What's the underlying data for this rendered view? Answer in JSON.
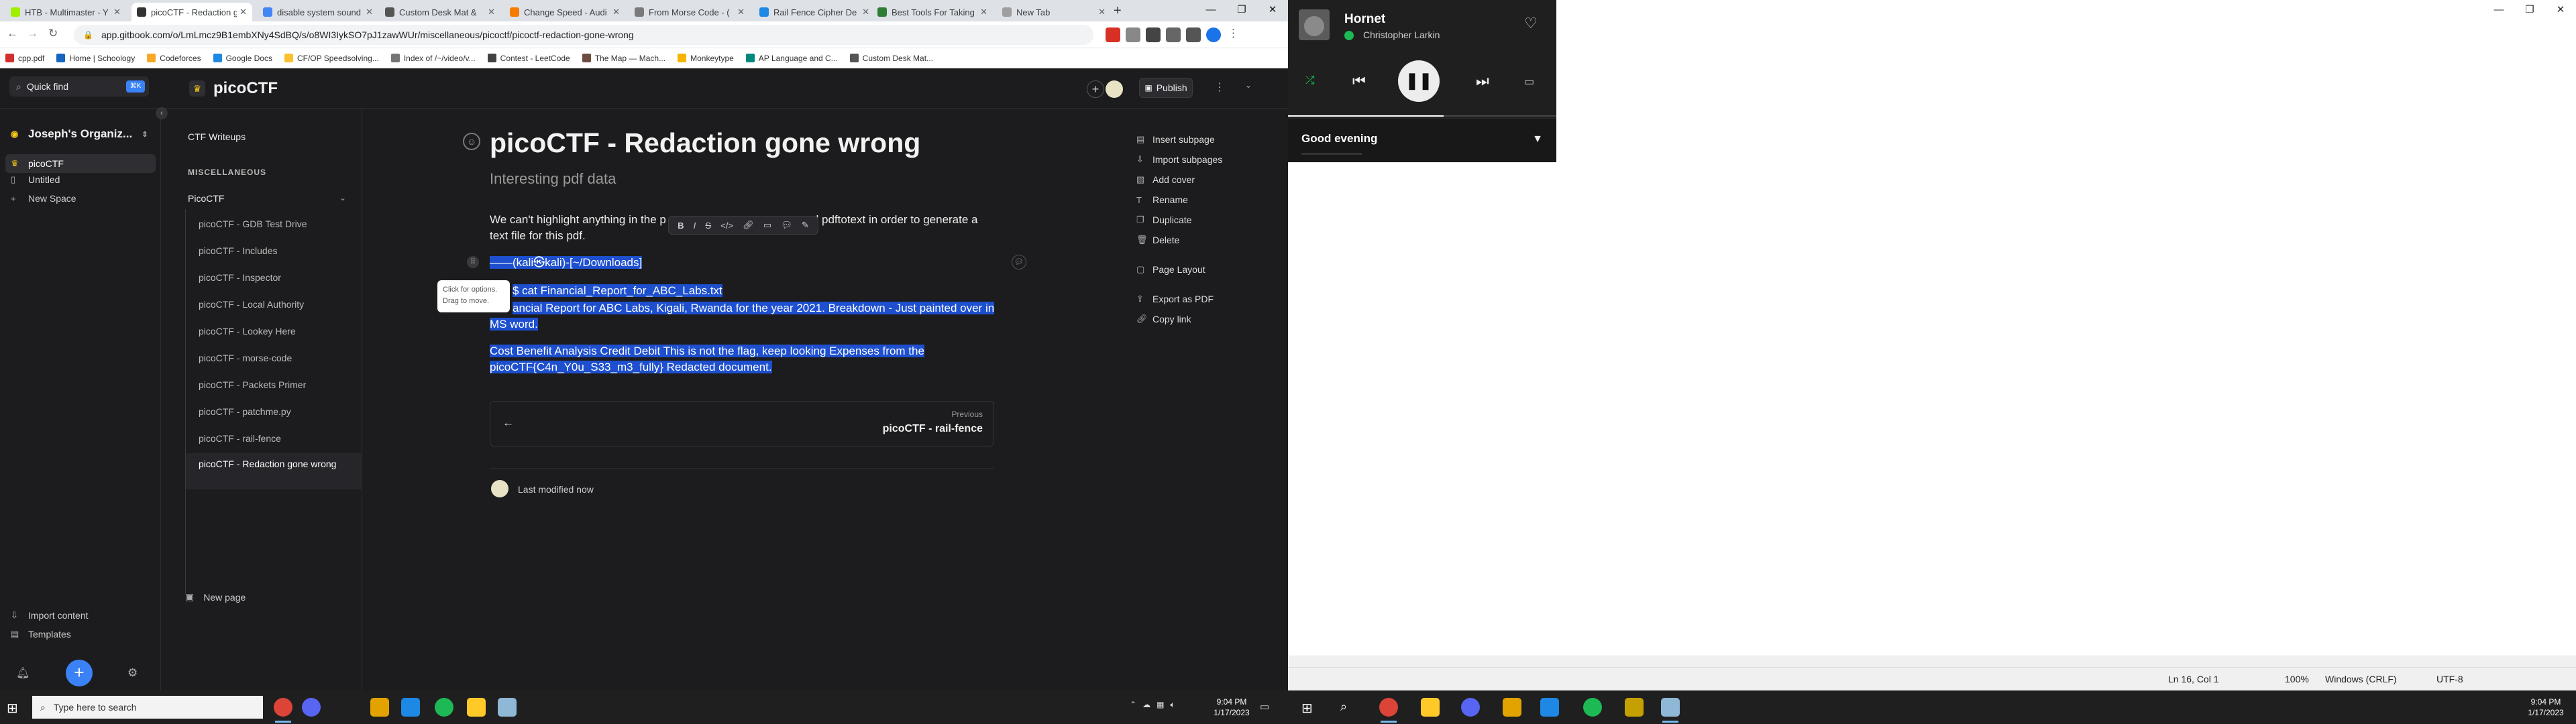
{
  "browser": {
    "tabs": [
      {
        "title": "HTB - Multimaster - Y",
        "color": "#9fef00"
      },
      {
        "title": "picoCTF - Redaction g",
        "color": "#333333",
        "active": true
      },
      {
        "title": "disable system sound",
        "color": "#4285f4"
      },
      {
        "title": "Custom Desk Mat &",
        "color": "#555555"
      },
      {
        "title": "Change Speed - Audi",
        "color": "#f57c00"
      },
      {
        "title": "From Morse Code - (",
        "color": "#7a7a7a"
      },
      {
        "title": "Rail Fence Cipher De",
        "color": "#1e88e5"
      },
      {
        "title": "Best Tools For Taking",
        "color": "#2e7d32"
      },
      {
        "title": "New Tab",
        "color": "#9e9e9e"
      }
    ],
    "new_tab": "+",
    "url": "app.gitbook.com/o/LmLmcz9B1embXNy4SdBQ/s/o8WI3IykSO7pJ1zawWUr/miscellaneous/picoctf/picoctf-redaction-gone-wrong",
    "bookmarks": [
      {
        "label": "cpp.pdf",
        "color": "#d32f2f"
      },
      {
        "label": "Home | Schoology",
        "color": "#1565c0"
      },
      {
        "label": "Codeforces",
        "color": "#f9a825"
      },
      {
        "label": "Google Docs",
        "color": "#1e88e5"
      },
      {
        "label": "CF/OP Speedsolving...",
        "color": "#fbc02d"
      },
      {
        "label": "Index of /~/video/v...",
        "color": "#757575"
      },
      {
        "label": "Contest - LeetCode",
        "color": "#424242"
      },
      {
        "label": "The Map — Mach...",
        "color": "#6d4c41"
      },
      {
        "label": "Monkeytype",
        "color": "#f4b400"
      },
      {
        "label": "AP Language and C...",
        "color": "#00897b"
      },
      {
        "label": "Custom Desk Mat...",
        "color": "#555555"
      }
    ]
  },
  "gitbook": {
    "quick_find": "Quick find",
    "quick_find_key": "⌘K",
    "space_title": "picoCTF",
    "publish": "Publish",
    "org_name": "Joseph's Organiz...",
    "org_items": {
      "picoctf": "picoCTF",
      "untitled": "Untitled",
      "new_space": "New Space"
    },
    "import_content": "Import content",
    "templates": "Templates",
    "sidebar": {
      "writeups": "CTF Writeups",
      "section": "MISCELLANEOUS",
      "group": "PicoCTF",
      "pages": [
        "picoCTF - GDB Test Drive",
        "picoCTF - Includes",
        "picoCTF - Inspector",
        "picoCTF - Local Authority",
        "picoCTF - Lookey Here",
        "picoCTF - morse-code",
        "picoCTF - Packets Primer",
        "picoCTF - patchme.py",
        "picoCTF - rail-fence",
        "picoCTF - Redaction gone wrong"
      ],
      "new_page": "New page"
    },
    "page": {
      "title": "picoCTF - Redaction gone wrong",
      "description": "Interesting pdf data",
      "p1a": "We can't highlight anything in the p",
      "p1b": "d pdftotext in order to generate a",
      "p1c": "text file for this pdf.",
      "code_prompt": "——(kali㉿kali)-[~/Downloads]",
      "code_cmd": "$ cat Financial_Report_for_ABC_Labs.txt",
      "code_out1": "ancial Report for ABC Labs, Kigali, Rwanda for the year 2021. Breakdown - Just painted over in",
      "code_out2": "MS word.",
      "flag1": "Cost Benefit Analysis Credit Debit This is not the flag, keep looking Expenses from the",
      "flag2": "picoCTF{C4n_Y0u_S33_m3_fully} Redacted document.",
      "tooltip1": "Click for options.",
      "tooltip2": "Drag to move.",
      "next_label": "Previous",
      "next_title": "picoCTF - rail-fence",
      "last_modified": "Last modified now"
    },
    "page_menu": [
      "Insert subpage",
      "Import subpages",
      "Add cover",
      "Rename",
      "Duplicate",
      "Delete",
      "Page Layout",
      "Export as PDF",
      "Copy link"
    ]
  },
  "taskbar": {
    "search_placeholder": "Type here to search",
    "time": "9:04 PM",
    "date": "1/17/2023"
  },
  "spotify": {
    "song": "Hornet",
    "artist": "Christopher Larkin",
    "greeting": "Good evening",
    "progress_fraction": 0.58,
    "accent": "#1db954"
  },
  "notepad": {
    "position": "Ln 16, Col 1",
    "zoom": "100%",
    "line_ending": "Windows (CRLF)",
    "encoding": "UTF-8"
  },
  "taskbar_right": {
    "time": "9:04 PM",
    "date": "1/17/2023"
  }
}
